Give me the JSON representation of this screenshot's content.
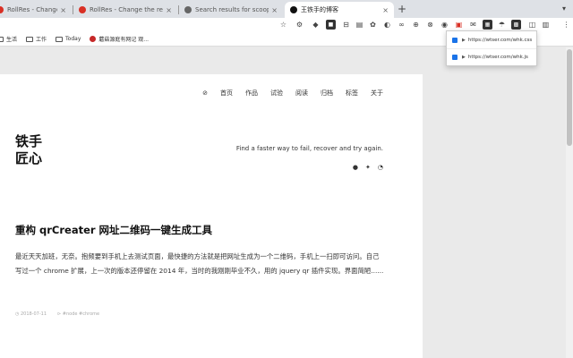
{
  "tabs": [
    {
      "title": "RollRes - Change the roll",
      "active": false,
      "favicon_color": "#d93025"
    },
    {
      "title": "RollRes - Change the response",
      "active": false,
      "favicon_color": "#d93025"
    },
    {
      "title": "Search results for scoop - Flat",
      "active": false,
      "favicon_color": "#555555"
    },
    {
      "title": "王铁手的博客",
      "active": true,
      "favicon_color": "#111111"
    }
  ],
  "toolbar_icons": [
    "☆",
    "⚙",
    "◆",
    "■",
    "⊟",
    "▤",
    "✿",
    "◐",
    "∞",
    "⊕",
    "⊗",
    "◉",
    "▣",
    "✉",
    "▦",
    "☂",
    "▩",
    "◫",
    "▥",
    "▤",
    "◧",
    "⊞",
    "✦",
    "⋮"
  ],
  "bookmarks": [
    {
      "label": "生活",
      "type": "folder"
    },
    {
      "label": "工作",
      "type": "folder"
    },
    {
      "label": "Today",
      "type": "folder"
    },
    {
      "label": "蘑菇源庭有网记 观...",
      "type": "site"
    }
  ],
  "popup": {
    "items": [
      {
        "url": "https://wtser.com/whk.css"
      },
      {
        "url": "https://wtser.com/whk.js"
      }
    ]
  },
  "nav": {
    "items": [
      "首页",
      "作品",
      "试验",
      "阅读",
      "归档",
      "标签",
      "关于"
    ]
  },
  "logo": {
    "line1": "铁手",
    "line2": "匠心"
  },
  "tagline": "Find a faster way to fail, recover and try again.",
  "post": {
    "title": "重构 qrCreater 网址二维码一键生成工具",
    "excerpt": "最近天天加班，无奈。抱频要到手机上去测试页面，最快捷的方法就是把网址生成为一个二维码，手机上一扫即可访问。自己写过一个 chrome 扩展，上一次的版本还停留在 2014 年，当时的我刚刚毕业不久，用的 jquery qr 插件实现。界面简陋......",
    "meta_date": "2018-07-11",
    "meta_tags": "#node #chrome"
  },
  "colors": {
    "accent_blue": "#1a73e8",
    "page_bg": "#eaeaea",
    "tab_bg": "#dee1e6"
  }
}
